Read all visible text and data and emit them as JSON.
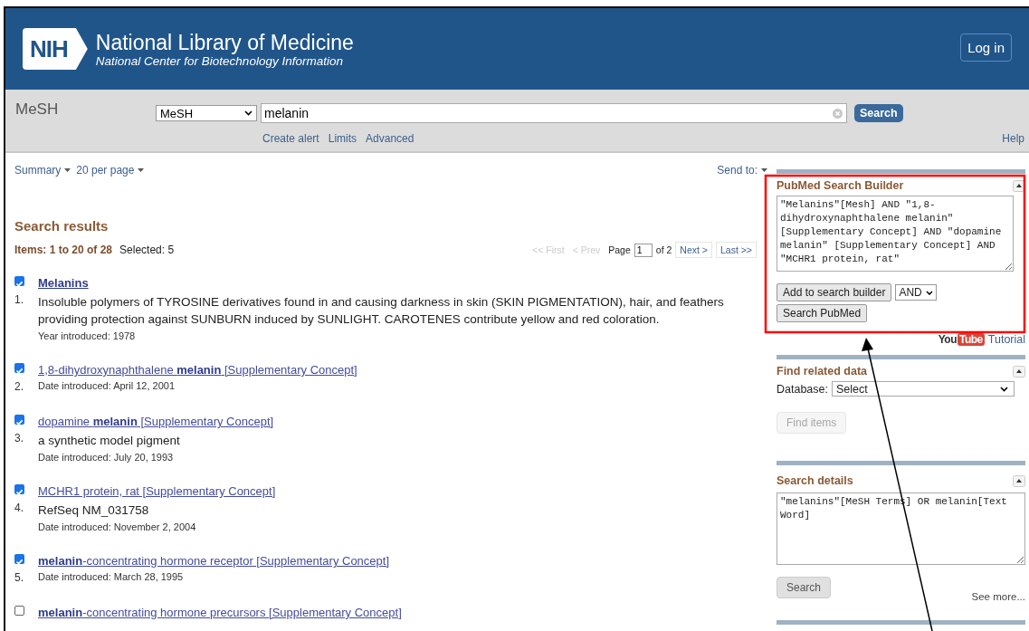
{
  "header": {
    "logo": "NIH",
    "title": "National Library of Medicine",
    "subtitle": "National Center for Biotechnology Information",
    "login": "Log in"
  },
  "search_bar": {
    "database_label": "MeSH",
    "database_select": "MeSH",
    "query": "melanin",
    "search_button": "Search",
    "links": [
      "Create alert",
      "Limits",
      "Advanced"
    ],
    "help": "Help"
  },
  "display": {
    "format": "Summary",
    "per_page": "20 per page",
    "send_to": "Send to:"
  },
  "results": {
    "heading": "Search results",
    "items_label": "Items: 1 to 20 of 28",
    "selected_label": "Selected: 5",
    "pager": {
      "first": "<< First",
      "prev": "< Prev",
      "page_label": "Page",
      "page": "1",
      "of": "of 2",
      "next": "Next >",
      "last": "Last >>"
    },
    "items": [
      {
        "number": "1.",
        "title": "Melanins",
        "bold": true,
        "checked": true,
        "description": "Insoluble polymers of TYROSINE derivatives found in and causing darkness in skin (SKIN PIGMENTATION), hair, and feathers providing protection against SUNBURN induced by SUNLIGHT. CAROTENES contribute yellow and red coloration.",
        "meta": "Year introduced: 1978"
      },
      {
        "number": "2.",
        "title": "1,8-dihydroxynaphthalene **melanin** [Supplementary Concept]",
        "bold": false,
        "checked": true,
        "meta": "Date introduced: April 12, 2001"
      },
      {
        "number": "3.",
        "title": "dopamine **melanin** [Supplementary Concept]",
        "bold": false,
        "checked": true,
        "description": "a synthetic model pigment",
        "meta": "Date introduced: July 20, 1993"
      },
      {
        "number": "4.",
        "title": "MCHR1 protein, rat [Supplementary Concept]",
        "bold": false,
        "checked": true,
        "description": "RefSeq NM_031758",
        "meta": "Date introduced: November 2, 2004"
      },
      {
        "number": "5.",
        "title": "**melanin**-concentrating hormone receptor [Supplementary Concept]",
        "bold": false,
        "checked": true,
        "meta": "Date introduced: March 28, 1995"
      },
      {
        "title": "**melanin**-concentrating hormone precursors [Supplementary Concept]",
        "bold": false,
        "checked": false
      }
    ]
  },
  "sidebar": {
    "builder": {
      "title": "PubMed Search Builder",
      "query": "\"Melanins\"[Mesh] AND \"1,8-dihydroxynaphthalene melanin\" [Supplementary Concept] AND \"dopamine melanin\" [Supplementary Concept] AND \"MCHR1 protein, rat\"",
      "add_button": "Add to search builder",
      "operator": "AND",
      "search_button": "Search PubMed"
    },
    "tutorial": {
      "logo_you": "You",
      "logo_tube": "Tube",
      "link": "Tutorial"
    },
    "related": {
      "title": "Find related data",
      "database_label": "Database:",
      "database_select": "Select",
      "find_button": "Find items",
      "find_disabled": true
    },
    "details": {
      "title": "Search details",
      "query": "\"melanins\"[MeSH Terms] OR melanin[Text Word]",
      "search_button": "Search",
      "see_more": "See more..."
    }
  }
}
